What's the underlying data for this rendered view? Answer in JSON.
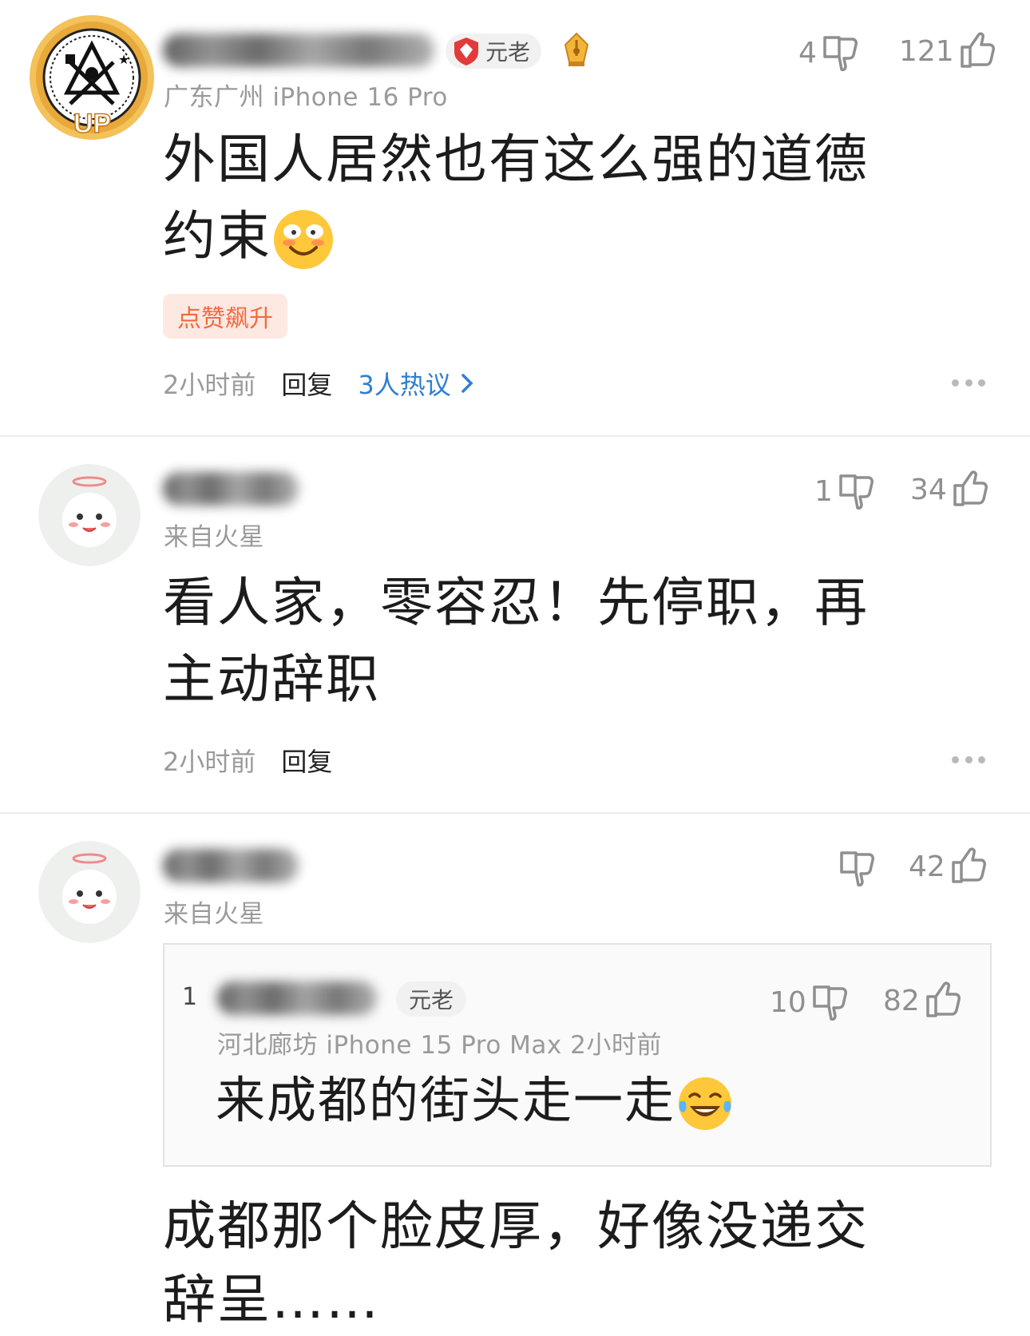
{
  "comments": [
    {
      "author_badge": "元老",
      "meta": "广东广州  iPhone 16 Pro",
      "text_line1": "外国人居然也有这么强的道德",
      "text_line2": "约束",
      "emoji": "grinning-tears-emoji",
      "tag": "点赞飙升",
      "time": "2小时前",
      "reply": "回复",
      "hot_discussion": "3人热议",
      "dislikes": "4",
      "likes": "121"
    },
    {
      "meta": "来自火星",
      "text_line1": "看人家，零容忍！先停职，再",
      "text_line2": "主动辞职",
      "time": "2小时前",
      "reply": "回复",
      "dislikes": "1",
      "likes": "34"
    },
    {
      "meta": "来自火星",
      "likes": "42",
      "quoted": {
        "index": "1",
        "badge": "元老",
        "meta": "河北廊坊  iPhone 15 Pro Max  2小时前",
        "text": "来成都的街头走一走",
        "emoji": "tears-of-joy-emoji",
        "dislikes": "10",
        "likes": "82"
      },
      "text_line1": "成都那个脸皮厚，好像没递交",
      "text_line2": "辞呈……"
    }
  ],
  "colors": {
    "meta_gray": "#9a9a9a",
    "link_blue": "#2f7fd1",
    "tag_bg": "#fde9e2",
    "tag_text": "#f26a3d",
    "divider": "#ececec"
  }
}
